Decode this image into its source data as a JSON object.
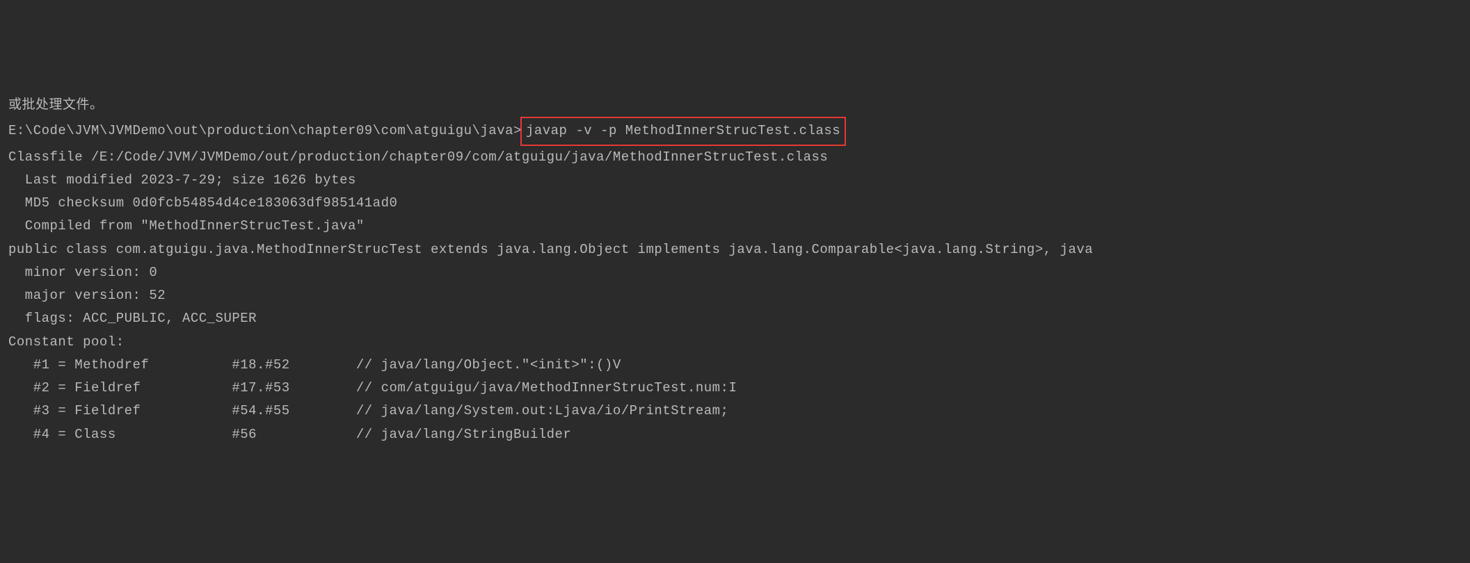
{
  "terminal": {
    "header_text": "或批处理文件。",
    "blank_line": "",
    "prompt_path": "E:\\Code\\JVM\\JVMDemo\\out\\production\\chapter09\\com\\atguigu\\java>",
    "command": "javap -v -p MethodInnerStrucTest.class",
    "output_lines": [
      "Classfile /E:/Code/JVM/JVMDemo/out/production/chapter09/com/atguigu/java/MethodInnerStrucTest.class",
      "  Last modified 2023-7-29; size 1626 bytes",
      "  MD5 checksum 0d0fcb54854d4ce183063df985141ad0",
      "  Compiled from \"MethodInnerStrucTest.java\"",
      "public class com.atguigu.java.MethodInnerStrucTest extends java.lang.Object implements java.lang.Comparable<java.lang.String>, java",
      "  minor version: 0",
      "  major version: 52",
      "  flags: ACC_PUBLIC, ACC_SUPER",
      "Constant pool:",
      "   #1 = Methodref          #18.#52        // java/lang/Object.\"<init>\":()V",
      "   #2 = Fieldref           #17.#53        // com/atguigu/java/MethodInnerStrucTest.num:I",
      "   #3 = Fieldref           #54.#55        // java/lang/System.out:Ljava/io/PrintStream;",
      "   #4 = Class              #56            // java/lang/StringBuilder"
    ]
  }
}
